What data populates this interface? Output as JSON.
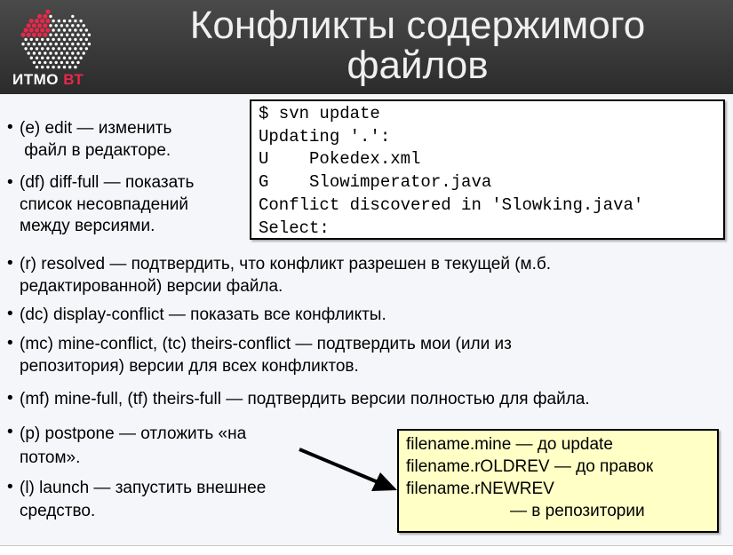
{
  "logo": {
    "text_main": "ИТМО",
    "text_accent": "ВТ",
    "accent_color": "#e8284a"
  },
  "title": {
    "line1": "Конфликты содержимого",
    "line2": "файлов"
  },
  "bullets": [
    {
      "lines": [
        "(e)  edit — изменить",
        " файл в редакторе."
      ]
    },
    {
      "lines": [
        "(df) diff-full — показать",
        "список несовпадений",
        "между версиями."
      ]
    },
    {
      "lines": [
        "(r)  resolved — подтвердить, что конфликт разрешен в текущей (м.б.",
        "редактированной) версии файла."
      ]
    },
    {
      "lines": [
        "(dc) display-conflict — показать все конфликты."
      ]
    },
    {
      "lines": [
        "(mc) mine-conflict,  (tc) theirs-conflict — подтвердить мои (или из",
        "репозитория) версии для всех конфликтов."
      ]
    },
    {
      "lines": [
        "(mf) mine-full, (tf) theirs-full — подтвердить версии полностью для файла."
      ]
    },
    {
      "lines": [
        "(p)  postpone — отложить «на",
        "потом»."
      ]
    },
    {
      "lines": [
        "(l)  launch — запустить внешнее",
        "средство."
      ]
    }
  ],
  "terminal": {
    "lines": [
      "$ svn update",
      "Updating '.':",
      "U    Pokedex.xml",
      "G    Slowimperator.java",
      "Conflict discovered in 'Slowking.java'",
      "Select:"
    ]
  },
  "note": {
    "lines": [
      "filename.mine — до update",
      "filename.rOLDREV — до правок",
      "filename.rNEWREV",
      "— в репозитории"
    ],
    "background": "#ffffc6"
  }
}
